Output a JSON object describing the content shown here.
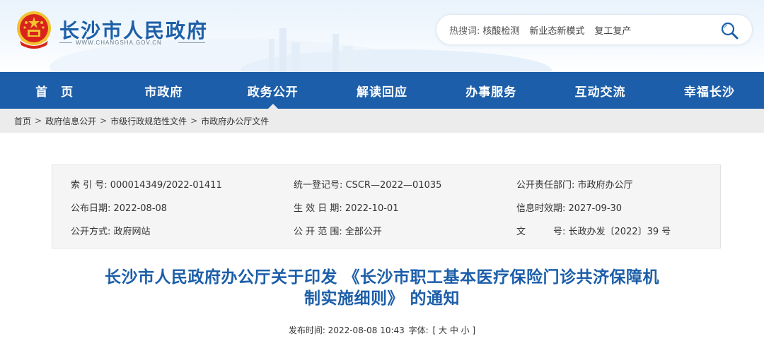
{
  "header": {
    "site_title": "长沙市人民政府",
    "site_domain": "WWW.CHANGSHA.GOV.CN",
    "search": {
      "hot_label": "热搜词:",
      "hot_words": [
        "核酸检测",
        "新业态新模式",
        "复工复产"
      ]
    }
  },
  "nav": {
    "items": [
      "首　页",
      "市政府",
      "政务公开",
      "解读回应",
      "办事服务",
      "互动交流",
      "幸福长沙"
    ],
    "active_index": 2
  },
  "breadcrumb": [
    "首页",
    "政府信息公开",
    "市级行政规范性文件",
    "市政府办公厅文件"
  ],
  "meta": {
    "index_no": "索 引 号:  000014349/2022-01411",
    "reg_no": "统一登记号:  CSCR—2022—01035",
    "dept": "公开责任部门:  市政府办公厅",
    "pub_date": "公布日期:  2022-08-08",
    "effective_date": "生 效 日 期:  2022-10-01",
    "valid_until": "信息时效期:  2027-09-30",
    "method": "公开方式:  政府网站",
    "scope": "公 开 范 围:  全部公开",
    "doc_no_label": "文　　　号:",
    "doc_no": "长政办发〔2022〕39 号"
  },
  "document": {
    "title_line1": "长沙市人民政府办公厅关于印发 《长沙市职工基本医疗保险门诊共济保障机",
    "title_line2": "制实施细则》 的通知",
    "publish_time": "发布时间: 2022-08-08 10:43",
    "font_label": "字体:",
    "font_sizes": "[ 大 中 小 ]"
  },
  "colors": {
    "brand_blue": "#1c5ea9",
    "nav_bg": "#1c5ea9",
    "breadcrumb_bg": "#ececec",
    "emblem_red": "#d9241c",
    "emblem_gold": "#f2c230"
  }
}
